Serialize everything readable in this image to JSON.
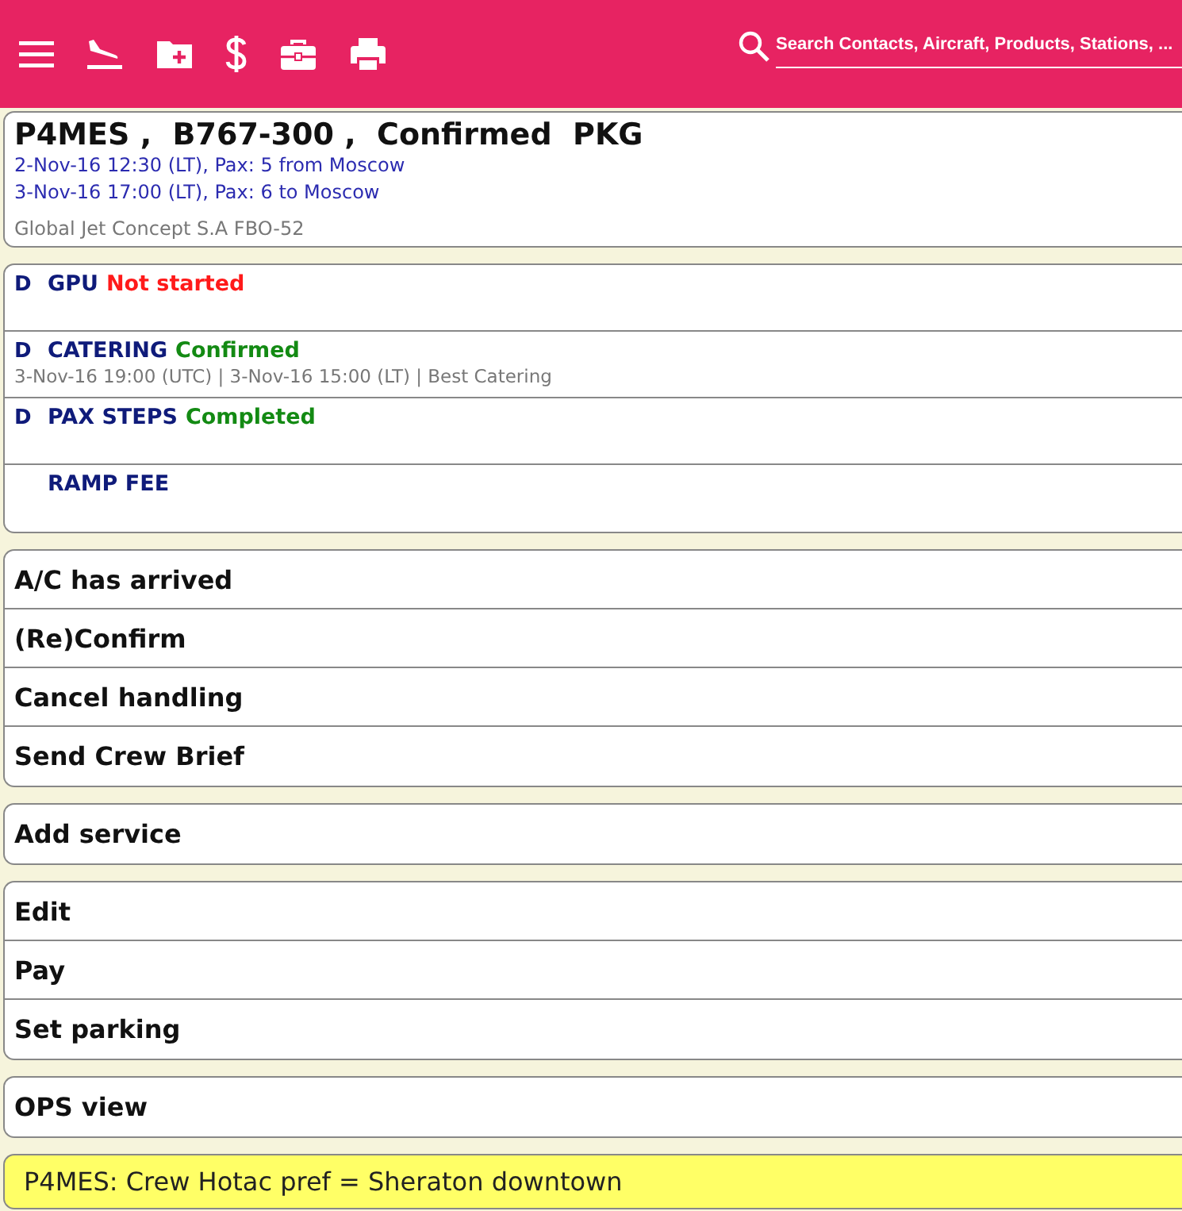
{
  "toolbar": {
    "search": {
      "placeholder": "Search Contacts, Aircraft, Products, Stations, ..."
    }
  },
  "flight": {
    "title": "P4MES ,  B767-300 ,  Confirmed  PKG",
    "legs": [
      "2-Nov-16 12:30 (LT), Pax: 5 from Moscow",
      "3-Nov-16 17:00 (LT), Pax: 6 to Moscow"
    ],
    "handler": "Global Jet Concept S.A FBO-52"
  },
  "services": [
    {
      "flag": "D",
      "name": "GPU",
      "status": "Not started",
      "color": "#ff1a1a"
    },
    {
      "flag": "D",
      "name": "CATERING",
      "status": "Confirmed",
      "color": "#138a13",
      "detail": "3-Nov-16 19:00 (UTC) | 3-Nov-16 15:00 (LT) | Best Catering"
    },
    {
      "flag": "D",
      "name": "PAX STEPS",
      "status": "Completed",
      "color": "#138a13"
    },
    {
      "name": "RAMP FEE"
    }
  ],
  "action_groups": [
    [
      "A/C has arrived",
      "(Re)Confirm",
      "Cancel handling",
      "Send Crew Brief"
    ],
    [
      "Add service"
    ],
    [
      "Edit",
      "Pay",
      "Set parking"
    ],
    [
      "OPS view"
    ]
  ],
  "note": "P4MES: Crew Hotac pref = Sheraton downtown"
}
